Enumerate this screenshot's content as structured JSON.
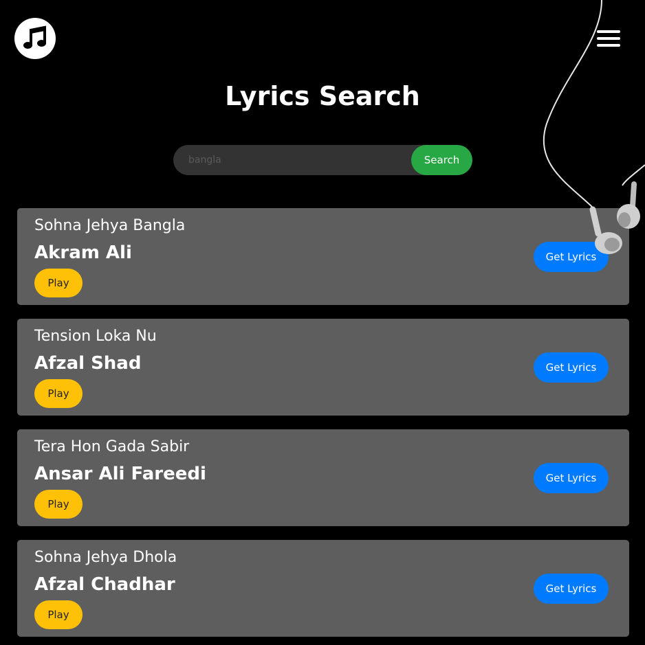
{
  "header": {
    "logo_icon": "music-note-icon",
    "menu_icon": "hamburger-menu-icon"
  },
  "title": "Lyrics Search",
  "search": {
    "placeholder": "bangla",
    "button_label": "Search"
  },
  "results": [
    {
      "title": "Sohna Jehya Bangla",
      "artist": "Akram Ali",
      "play_label": "Play",
      "lyrics_label": "Get Lyrics"
    },
    {
      "title": "Tension Loka Nu",
      "artist": "Afzal Shad",
      "play_label": "Play",
      "lyrics_label": "Get Lyrics"
    },
    {
      "title": "Tera Hon Gada Sabir",
      "artist": "Ansar Ali Fareedi",
      "play_label": "Play",
      "lyrics_label": "Get Lyrics"
    },
    {
      "title": "Sohna Jehya Dhola",
      "artist": "Afzal Chadhar",
      "play_label": "Play",
      "lyrics_label": "Get Lyrics"
    }
  ],
  "colors": {
    "background": "#000000",
    "card": "#5e5e5e",
    "search_button": "#28a745",
    "play_button": "#ffc107",
    "lyrics_button": "#007bff"
  }
}
